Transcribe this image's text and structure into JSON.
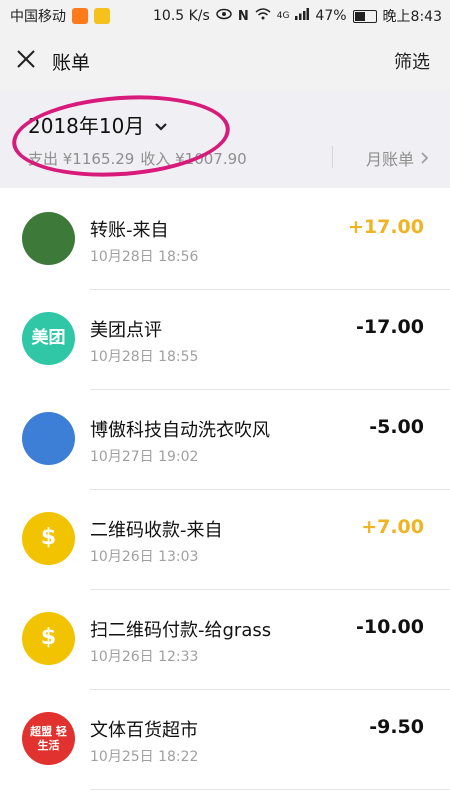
{
  "status_bar": {
    "carrier": "中国移动",
    "speed": "10.5 K/s",
    "network": "4G",
    "battery": "47%",
    "battery_level": 0.47,
    "time": "晚上8:43"
  },
  "header": {
    "title": "账单",
    "filter": "筛选",
    "close_icon": "close-icon"
  },
  "summary": {
    "month": "2018年10月",
    "totals": [
      "支出 ¥1165.29",
      "收入 ¥1007.90"
    ],
    "monthly_bill": "月账单"
  },
  "transactions": [
    {
      "name": "转账-来自",
      "time": "10月28日 18:56",
      "amount": "+17.00",
      "type": "income",
      "avatar_label": "",
      "avatar_color": "#3d7a3a"
    },
    {
      "name": "美团点评",
      "time": "10月28日 18:55",
      "amount": "-17.00",
      "type": "expense",
      "avatar_label": "美团",
      "avatar_color": "#2fc7a6"
    },
    {
      "name": "博傲科技自动洗衣吹风",
      "time": "10月27日 19:02",
      "amount": "-5.00",
      "type": "expense",
      "avatar_label": "",
      "avatar_color": "#3d7fd6"
    },
    {
      "name": "二维码收款-来自",
      "time": "10月26日 13:03",
      "amount": "+7.00",
      "type": "income",
      "avatar_label": "$",
      "avatar_color": "#f2c300"
    },
    {
      "name": "扫二维码付款-给grass",
      "time": "10月26日 12:33",
      "amount": "-10.00",
      "type": "expense",
      "avatar_label": "$",
      "avatar_color": "#f2c300"
    },
    {
      "name": "文体百货超市",
      "time": "10月25日 18:22",
      "amount": "-9.50",
      "type": "expense",
      "avatar_label": "超盟 轻生活",
      "avatar_color": "#e2322f"
    }
  ]
}
